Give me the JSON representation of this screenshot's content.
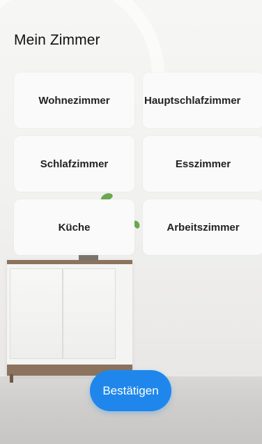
{
  "header": {
    "title": "Mein Zimmer"
  },
  "rooms": [
    {
      "label": "Wohnezimmer"
    },
    {
      "label": "Hauptschlafzimmer"
    },
    {
      "label": "Schlafzimmer"
    },
    {
      "label": "Esszimmer"
    },
    {
      "label": "Küche"
    },
    {
      "label": "Arbeitszimmer"
    }
  ],
  "actions": {
    "confirm_label": "Bestätigen"
  },
  "colors": {
    "accent": "#1f87ec",
    "card_background": "#fafafa",
    "text_primary": "#111111"
  }
}
